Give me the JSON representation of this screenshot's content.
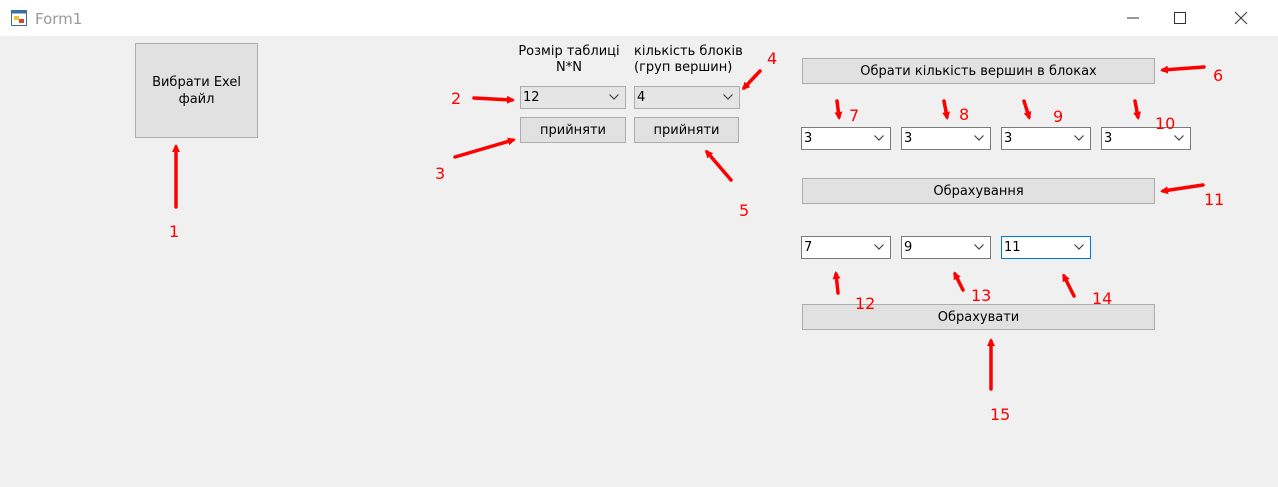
{
  "window": {
    "title": "Form1"
  },
  "buttons": {
    "choose_excel": "Вибрати Exel файл",
    "accept_size": "прийняти",
    "accept_blocks": "прийняти",
    "choose_vertex_count": "Обрати кількість вершин в блоках",
    "calculation": "Обрахування",
    "calculate": "Обрахувати"
  },
  "labels": {
    "table_size_line1": "Розмір таблиці",
    "table_size_line2": "N*N",
    "blocks_line1": "кількість блоків",
    "blocks_line2": "(груп вершин)"
  },
  "combos": {
    "table_size": "12",
    "blocks": "4",
    "vertices": [
      "3",
      "3",
      "3",
      "3"
    ],
    "results": [
      "7",
      "9",
      "11"
    ]
  },
  "annotations": {
    "n1": "1",
    "n2": "2",
    "n3": "3",
    "n4": "4",
    "n5": "5",
    "n6": "6",
    "n7": "7",
    "n8": "8",
    "n9": "9",
    "n10": "10",
    "n11": "11",
    "n12": "12",
    "n13": "13",
    "n14": "14",
    "n15": "15"
  },
  "colors": {
    "annotation": "#ff0000",
    "focus_border": "#0078d7"
  },
  "icons": [
    "form-icon",
    "minimize-icon",
    "maximize-icon",
    "close-icon",
    "chevron-down-icon",
    "red-arrow-icon"
  ]
}
